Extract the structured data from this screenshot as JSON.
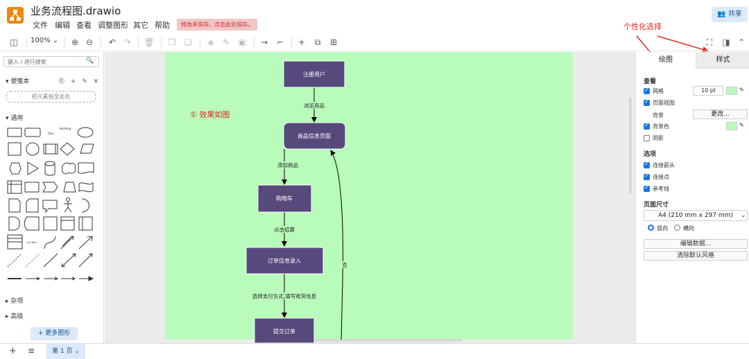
{
  "app": {
    "file_title": "业务流程图.drawio",
    "menu": [
      "文件",
      "编辑",
      "查看",
      "调整图形",
      "其它",
      "帮助"
    ],
    "unsaved_notice": "修改未保存。点击此处保存。",
    "share_label": "共享"
  },
  "annotations": {
    "personalize": "个性化选择",
    "effect": "① 效果如图"
  },
  "toolbar": {
    "zoom": "100%"
  },
  "sidebar": {
    "search_placeholder": "键入 / 进行搜索",
    "scratchpad_title": "便笺本",
    "scratchpad_icons": "⓪ + ✎ ✕",
    "scratchpad_drop": "把元素拖至此处",
    "general_title": "通用",
    "misc_title": "杂项",
    "advanced_title": "高级",
    "more_shapes": "+ 更多图形",
    "text_shape": "Text",
    "heading_shape": "Heading",
    "list_shape": "List Item"
  },
  "diagram": {
    "nodes": {
      "register": "注册用户",
      "product": "商品信息页面",
      "cart": "购物车",
      "order": "订单信息录入",
      "submit": "提交订单"
    },
    "edges": {
      "browse": "浏览商品",
      "add": "添加商品",
      "checkout": "点击结算",
      "pay": "选择支付方式,填写收货信息",
      "no": "否"
    }
  },
  "right_panel": {
    "tab_draw": "绘图",
    "tab_style": "样式",
    "view_title": "查看",
    "grid_label": "网格",
    "grid_size": "10 pt",
    "page_view_label": "页面视图",
    "background_label": "背景",
    "change_button": "更改...",
    "bg_color_label": "背景色",
    "shadow_label": "阴影",
    "options_title": "选项",
    "connection_arrows": "连接箭头",
    "connection_points": "连接点",
    "guides": "参考线",
    "paper_size_title": "页面尺寸",
    "paper_size": "A4 (210 mm x 297 mm)",
    "portrait": "竖向",
    "landscape": "横向",
    "edit_data": "编辑数据...",
    "clear_style": "清除默认风格",
    "grid_color": "#b8fbba",
    "bg_color": "#b8fbba"
  },
  "bottom": {
    "page_tab": "第 1 页"
  },
  "colors": {
    "node_fill": "#564a7d",
    "canvas_bg": "#b8fbba",
    "accent": "#1a73e8"
  }
}
